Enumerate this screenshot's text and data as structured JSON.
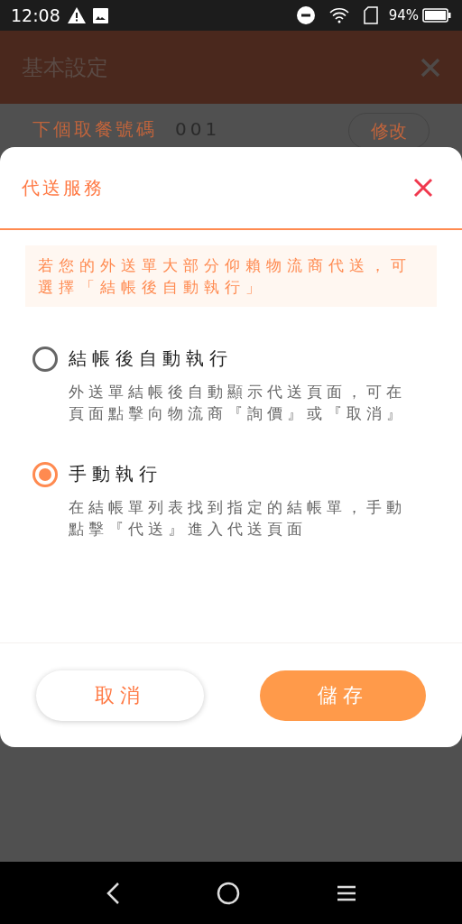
{
  "status_bar": {
    "time": "12:08",
    "battery": "94%"
  },
  "background_page": {
    "title": "基本設定",
    "row": {
      "label": "下個取餐號碼",
      "value": "001",
      "button": "修改"
    }
  },
  "dialog": {
    "title": "代送服務",
    "hint": "若您的外送單大部分仰賴物流商代送，可選擇「結帳後自動執行」",
    "options": [
      {
        "label": "結帳後自動執行",
        "description": "外送單結帳後自動顯示代送頁面，可在頁面點擊向物流商『詢價』或『取消』",
        "selected": false
      },
      {
        "label": "手動執行",
        "description": "在結帳單列表找到指定的結帳單，手動點擊『代送』進入代送頁面",
        "selected": true
      }
    ],
    "cancel": "取消",
    "save": "儲存"
  }
}
